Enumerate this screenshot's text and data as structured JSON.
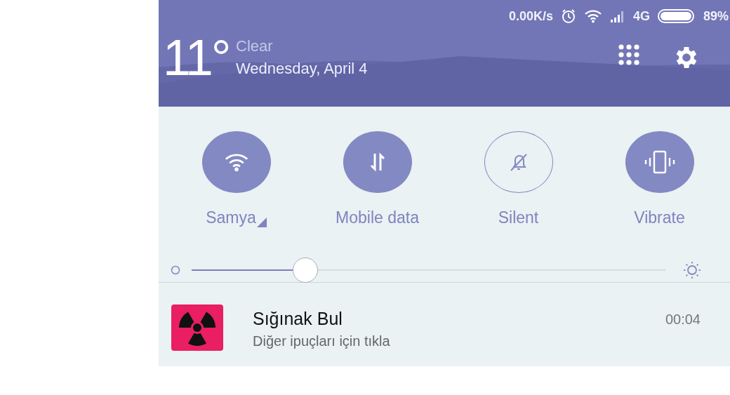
{
  "status_bar": {
    "speed": "0.00K/s",
    "network": "4G",
    "battery": "89%"
  },
  "weather": {
    "temperature": "11°",
    "condition": "Clear",
    "date": "Wednesday, April 4"
  },
  "toggles": [
    {
      "label": "Samya",
      "on": true,
      "has_menu": true
    },
    {
      "label": "Mobile data",
      "on": true,
      "has_menu": false
    },
    {
      "label": "Silent",
      "on": false,
      "has_menu": false
    },
    {
      "label": "Vibrate",
      "on": true,
      "has_menu": false
    }
  ],
  "brightness": {
    "level": 0.24
  },
  "notification": {
    "title": "Sığınak Bul",
    "text": "Diğer ipuçları için tıkla",
    "time": "00:04"
  }
}
